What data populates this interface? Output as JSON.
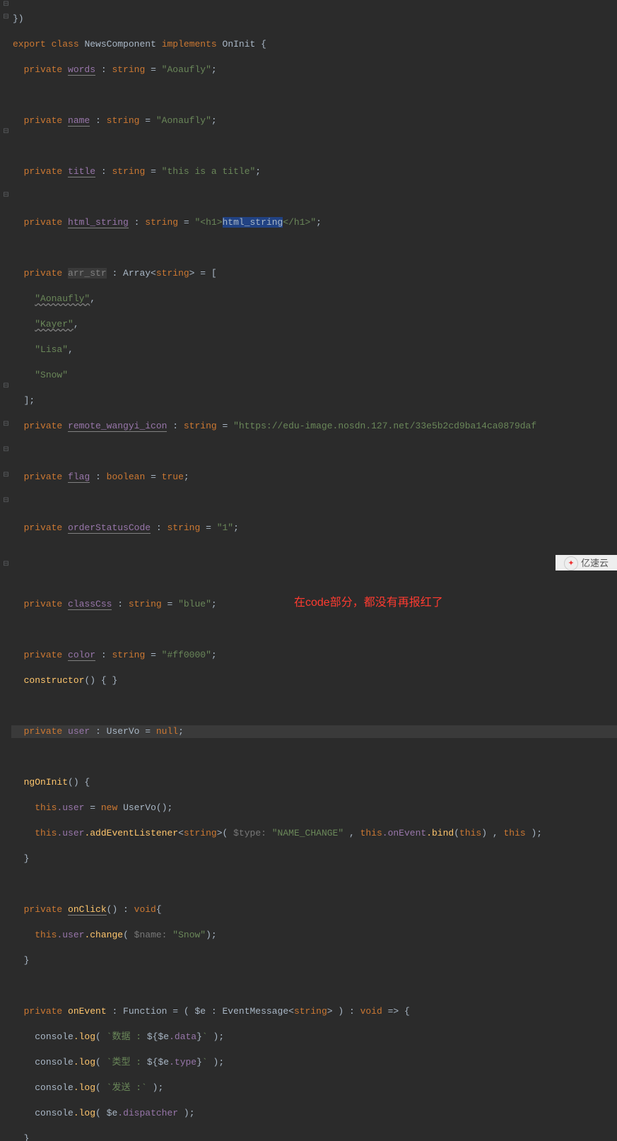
{
  "class_header": {
    "export": "export",
    "class": "class",
    "name": "NewsComponent",
    "implements": "implements",
    "iface": "OnInit",
    "brace": "{"
  },
  "decl": {
    "private": "private",
    "string_t": "string",
    "bool_t": "boolean",
    "true_v": "true",
    "null_v": "null",
    "void_t": "void",
    "this": "this",
    "new": "new"
  },
  "fields": {
    "words": "words",
    "words_v": "\"Aoaufly\"",
    "name": "name",
    "name_v": "\"Aonaufly\"",
    "title": "title",
    "title_v": "\"this is a title\"",
    "html": "html_string",
    "html_v1": "\"<h1>",
    "html_v2": "html_string",
    "html_v3": "</h1>\"",
    "arr": "arr_str",
    "arr_t1": "Array<",
    "arr_t2": ">",
    "arr_items": [
      "\"Aonaufly\"",
      "\"Kayer\"",
      "\"Lisa\"",
      "\"Snow\""
    ],
    "remote": "remote_wangyi_icon",
    "remote_v": "\"https://edu-image.nosdn.127.net/33e5b2cd9ba14ca0879daf",
    "flag": "flag",
    "order": "orderStatusCode",
    "order_v": "\"1\"",
    "classcss": "classCss",
    "classcss_v": "\"blue\"",
    "color": "color",
    "color_v": "\"#ff0000\"",
    "ctor": "constructor",
    "user": "user",
    "user_t": "UserVo"
  },
  "note_text": "在code部分，都没有再报红了",
  "ngOnInit": {
    "name": "ngOnInit",
    "line1a": ".user = ",
    "line1b": " UserVo();",
    "line2a": ".user.addEventListener<",
    "line2b": ">( ",
    "hint1": "$type:",
    "val1": "\"NAME_CHANGE\"",
    "mid": " , ",
    "onEvent": ".onEvent.bind(",
    "close": ") , ",
    "tail": " )"
  },
  "onClick": {
    "name": "onClick",
    "line1a": ".user.change( ",
    "hint": "$name:",
    "val": "\"Snow\"",
    "close": ");"
  },
  "onEvent": {
    "name": "onEvent",
    "sig1": " : Function = ( $e : EventMessage<",
    "sig2": "> ) : ",
    "arrow": " => {",
    "log": "console.log",
    "l1a": "`数据 : ${",
    "l1b": "$e.data",
    "l1c": "}` );",
    "l2a": "`类型 : ${",
    "l2b": "$e.type",
    "l2c": "}` );",
    "l3": "`发送 :` );",
    "l4a": " $e.dispatcher );"
  },
  "watermark": "亿速云"
}
